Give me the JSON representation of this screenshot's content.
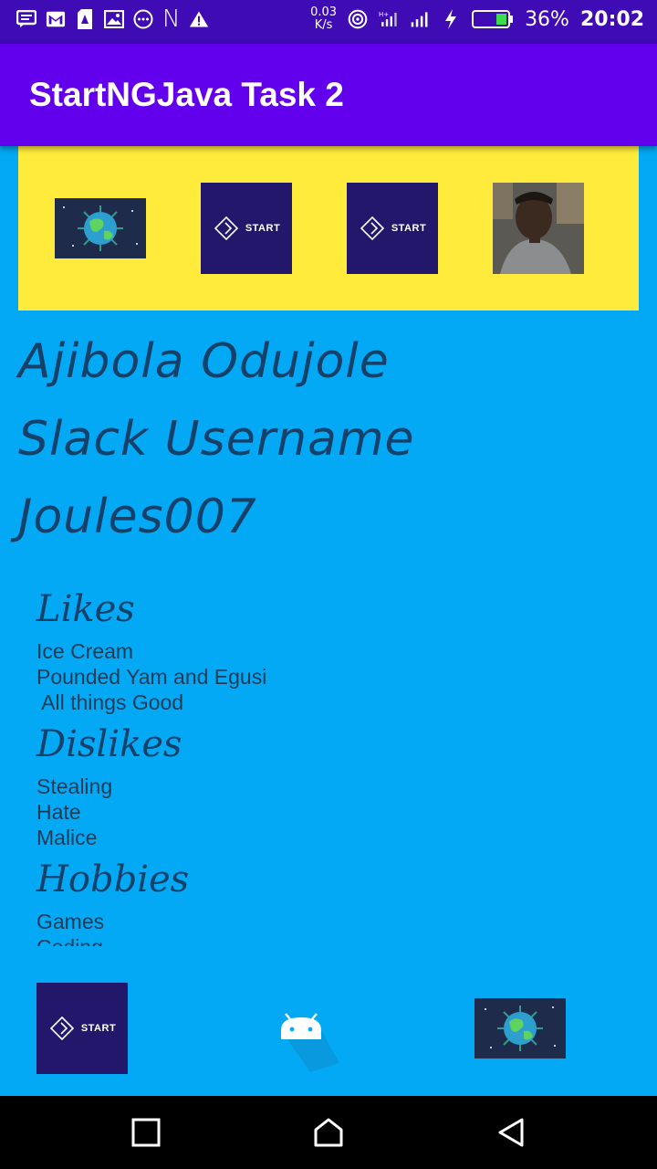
{
  "status_bar": {
    "speed_value": "0.03",
    "speed_unit": "K/s",
    "battery_percent": "36%",
    "time": "20:02",
    "n_letter": "N"
  },
  "app_bar": {
    "title": "StartNGJava Task 2"
  },
  "banner": {
    "start_label": "START"
  },
  "profile": {
    "name": "Ajibola Odujole",
    "slack_label": "Slack Username",
    "slack_username": "Joules007"
  },
  "likes": {
    "heading": "Likes",
    "items": [
      "Ice Cream",
      "Pounded Yam and Egusi",
      " All things Good"
    ]
  },
  "dislikes": {
    "heading": "Dislikes",
    "items": [
      "Stealing",
      "Hate",
      "Malice"
    ]
  },
  "hobbies": {
    "heading": "Hobbies",
    "items": [
      "Games",
      "Coding"
    ]
  },
  "footer": {
    "start_label": "START"
  },
  "colors": {
    "status_bar": "#3e0bb4",
    "app_bar": "#6200EE",
    "banner": "#FFEB3B",
    "background": "#03A9F4",
    "text": "#14416a"
  }
}
